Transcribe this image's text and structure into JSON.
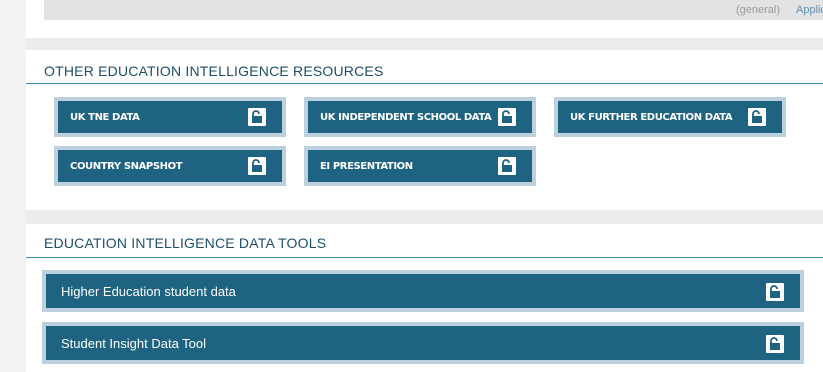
{
  "top_strip": {
    "cut_general": "(general)",
    "cut_application": "Application"
  },
  "resources": {
    "title": "OTHER EDUCATION INTELLIGENCE RESOURCES",
    "tiles": [
      {
        "label": "UK TNE DATA",
        "icon": "unlock-icon"
      },
      {
        "label": "UK INDEPENDENT SCHOOL DATA",
        "icon": "unlock-icon"
      },
      {
        "label": "UK FURTHER EDUCATION DATA",
        "icon": "unlock-icon"
      },
      {
        "label": "COUNTRY SNAPSHOT",
        "icon": "unlock-icon"
      },
      {
        "label": "EI PRESENTATION",
        "icon": "unlock-icon"
      }
    ]
  },
  "tools": {
    "title": "EDUCATION INTELLIGENCE DATA TOOLS",
    "items": [
      {
        "label": "Higher Education student data",
        "icon": "unlock-icon"
      },
      {
        "label": "Student Insight Data Tool",
        "icon": "unlock-icon"
      }
    ]
  },
  "colors": {
    "tile_fill": "#1f6383",
    "tile_border": "#bcd1dd",
    "heading_text": "#1d4f6b",
    "rule": "#3a8bb0"
  }
}
